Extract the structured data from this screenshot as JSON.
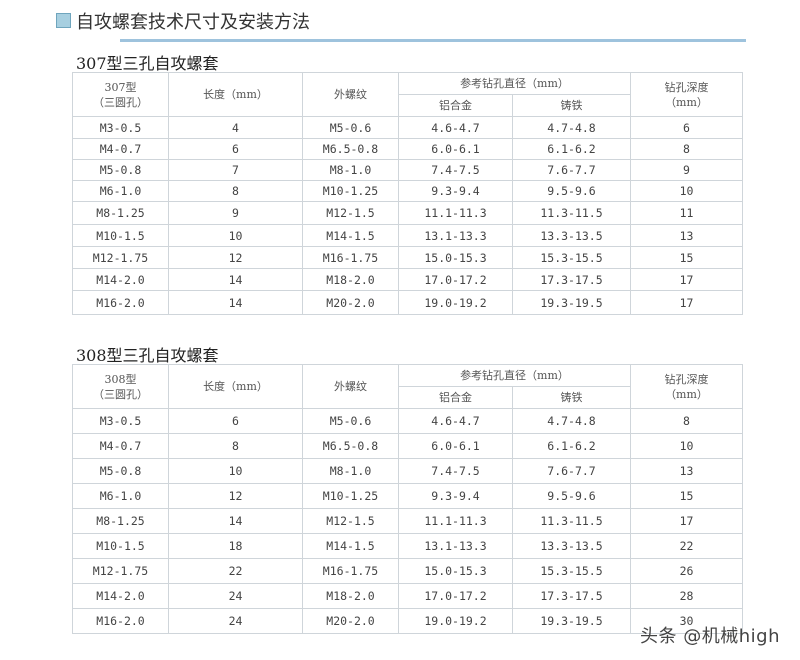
{
  "page_title": "自攻螺套技术尺寸及安装方法",
  "watermark": "头条 @机械high",
  "tables": [
    {
      "title": "307型三孔自攻螺套",
      "header": {
        "type_line1": "307型",
        "type_line2": "（三圆孔）",
        "length": "长度（mm）",
        "thread": "外螺纹",
        "ref_diameter": "参考钻孔直径（mm）",
        "aluminum": "铝合金",
        "cast_iron": "铸铁",
        "depth_line1": "钻孔深度",
        "depth_line2": "（mm）"
      },
      "rows": [
        [
          "M3-0.5",
          "4",
          "M5-0.6",
          "4.6-4.7",
          "4.7-4.8",
          "6"
        ],
        [
          "M4-0.7",
          "6",
          "M6.5-0.8",
          "6.0-6.1",
          "6.1-6.2",
          "8"
        ],
        [
          "M5-0.8",
          "7",
          "M8-1.0",
          "7.4-7.5",
          "7.6-7.7",
          "9"
        ],
        [
          "M6-1.0",
          "8",
          "M10-1.25",
          "9.3-9.4",
          "9.5-9.6",
          "10"
        ],
        [
          "M8-1.25",
          "9",
          "M12-1.5",
          "11.1-11.3",
          "11.3-11.5",
          "11"
        ],
        [
          "M10-1.5",
          "10",
          "M14-1.5",
          "13.1-13.3",
          "13.3-13.5",
          "13"
        ],
        [
          "M12-1.75",
          "12",
          "M16-1.75",
          "15.0-15.3",
          "15.3-15.5",
          "15"
        ],
        [
          "M14-2.0",
          "14",
          "M18-2.0",
          "17.0-17.2",
          "17.3-17.5",
          "17"
        ],
        [
          "M16-2.0",
          "14",
          "M20-2.0",
          "19.0-19.2",
          "19.3-19.5",
          "17"
        ]
      ]
    },
    {
      "title": "308型三孔自攻螺套",
      "header": {
        "type_line1": "308型",
        "type_line2": "（三圆孔）",
        "length": "长度（mm）",
        "thread": "外螺纹",
        "ref_diameter": "参考钻孔直径（mm）",
        "aluminum": "铝合金",
        "cast_iron": "铸铁",
        "depth_line1": "钻孔深度",
        "depth_line2": "（mm）"
      },
      "rows": [
        [
          "M3-0.5",
          "6",
          "M5-0.6",
          "4.6-4.7",
          "4.7-4.8",
          "8"
        ],
        [
          "M4-0.7",
          "8",
          "M6.5-0.8",
          "6.0-6.1",
          "6.1-6.2",
          "10"
        ],
        [
          "M5-0.8",
          "10",
          "M8-1.0",
          "7.4-7.5",
          "7.6-7.7",
          "13"
        ],
        [
          "M6-1.0",
          "12",
          "M10-1.25",
          "9.3-9.4",
          "9.5-9.6",
          "15"
        ],
        [
          "M8-1.25",
          "14",
          "M12-1.5",
          "11.1-11.3",
          "11.3-11.5",
          "17"
        ],
        [
          "M10-1.5",
          "18",
          "M14-1.5",
          "13.1-13.3",
          "13.3-13.5",
          "22"
        ],
        [
          "M12-1.75",
          "22",
          "M16-1.75",
          "15.0-15.3",
          "15.3-15.5",
          "26"
        ],
        [
          "M14-2.0",
          "24",
          "M18-2.0",
          "17.0-17.2",
          "17.3-17.5",
          "28"
        ],
        [
          "M16-2.0",
          "24",
          "M20-2.0",
          "19.0-19.2",
          "19.3-19.5",
          "30"
        ]
      ]
    }
  ]
}
